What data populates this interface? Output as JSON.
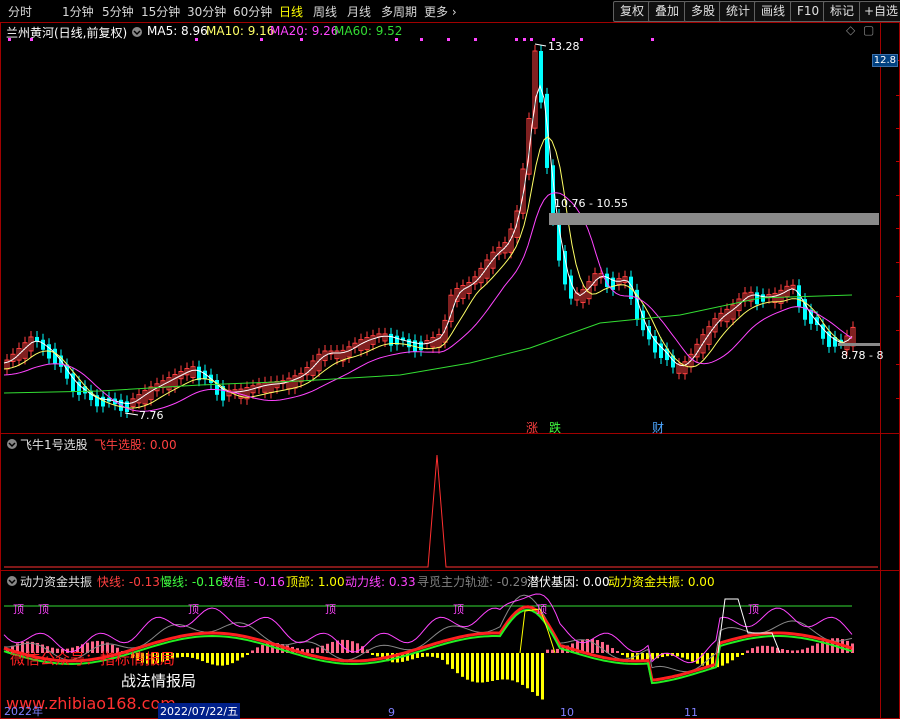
{
  "toolbar": {
    "periods": [
      "分时",
      "1分钟",
      "5分钟",
      "15分钟",
      "30分钟",
      "60分钟",
      "日线",
      "周线",
      "月线",
      "多周期",
      "更多"
    ],
    "active_period": "日线",
    "buttons": [
      "复权",
      "叠加",
      "多股",
      "统计",
      "画线",
      "F10",
      "标记",
      "+自选"
    ]
  },
  "main": {
    "stock_title": "兰州黄河(日线,前复权)",
    "ma": [
      {
        "label": "MA5: 8.96",
        "color": "#ffffff"
      },
      {
        "label": "MA10: 9.16",
        "color": "#ffff66"
      },
      {
        "label": "MA20: 9.26",
        "color": "#ff44ff"
      },
      {
        "label": "MA60: 9.52",
        "color": "#33dd33"
      }
    ],
    "high_label": "13.28",
    "low_label": "7.76",
    "range_label": "10.76 - 10.55",
    "right_label": "8.78 - 8",
    "right_price": "12.8",
    "markers": [
      {
        "text": "涨",
        "color": "#ff4040"
      },
      {
        "text": "跌",
        "color": "#40ff40"
      },
      {
        "text": "财",
        "color": "#4da6ff"
      }
    ]
  },
  "ind1": {
    "title": "飞牛1号选股",
    "value_label": "飞牛选股: 0.00"
  },
  "ind2": {
    "title": "动力资金共振",
    "items": [
      {
        "text": "快线: -0.13",
        "color": "#ff4040"
      },
      {
        "text": "慢线: -0.16",
        "color": "#40ff40"
      },
      {
        "text": "数值: -0.16",
        "color": "#ff44ff"
      },
      {
        "text": "顶部: 1.00",
        "color": "#ffff00"
      },
      {
        "text": "动力线: 0.33",
        "color": "#ff44ff"
      },
      {
        "text": "寻觅主力轨迹: -0.29",
        "color": "#808080"
      },
      {
        "text": "潜伏基因: 0.00",
        "color": "#ffffff"
      },
      {
        "text": "动力资金共振: 0.00",
        "color": "#ffff00"
      }
    ],
    "top_labels": [
      "顶",
      "顶",
      "顶",
      "顶",
      "顶",
      "顶",
      "顶"
    ]
  },
  "watermark": {
    "line1": "微信公众号：指标情报局",
    "line2": "战法情报局",
    "site": "www.zhibiao168.com"
  },
  "dates": [
    "2022年",
    "2022/07/22/五",
    "9",
    "10",
    "11"
  ],
  "colors": {
    "up": "#ff4040",
    "down": "#00ffff",
    "border": "#a00000"
  }
}
